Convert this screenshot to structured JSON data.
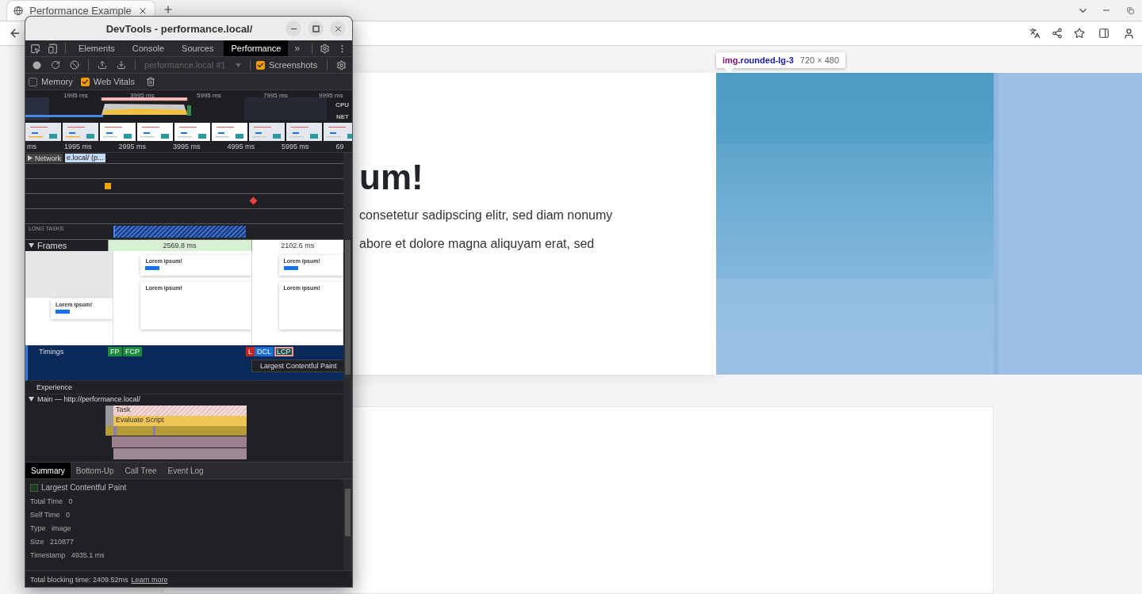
{
  "browser": {
    "tab_title": "Performance Example"
  },
  "page": {
    "inspect_tooltip": {
      "tag": "img",
      "class_name": ".rounded-lg-3",
      "size": "720 × 480"
    },
    "heading": "um!",
    "paragraph_lines": [
      "consetetur sadipscing elitr, sed diam nonumy",
      "abore et dolore magna aliquyam erat, sed"
    ]
  },
  "devtools": {
    "title": "DevTools - performance.local/",
    "tabs": [
      {
        "label": "Elements",
        "selected": false
      },
      {
        "label": "Console",
        "selected": false
      },
      {
        "label": "Sources",
        "selected": false
      },
      {
        "label": "Performance",
        "selected": true
      }
    ],
    "more_tabs": "»",
    "recording_select": "performance.local #1",
    "screenshots_option": {
      "label": "Screenshots",
      "checked": true
    },
    "options": [
      {
        "label": "Memory",
        "checked": false
      },
      {
        "label": "Web Vitals",
        "checked": true
      }
    ],
    "overview": {
      "ticks": [
        "1995 ms",
        "3995 ms",
        "5995 ms",
        "7995 ms",
        "9995 ms"
      ],
      "cpu_label": "CPU",
      "net_label": "NET"
    },
    "ruler": [
      "ms",
      "1995 ms",
      "2995 ms",
      "3995 ms",
      "4995 ms",
      "5995 ms",
      "69"
    ],
    "network": {
      "label": "Network",
      "request": "e.local/ (p..."
    },
    "long_tasks_label": "LONG TASKS",
    "frames": {
      "label": "Frames",
      "durations": [
        "2569.8 ms",
        "2102.6 ms"
      ],
      "screenshots": [
        {
          "headings": [
            "Lorem ipsum!"
          ]
        },
        {
          "headings": [
            "Lorem ipsum!",
            "Lorem ipsum!"
          ]
        },
        {
          "headings": [
            "Lorem ipsum!",
            "Lorem ipsum!"
          ]
        }
      ]
    },
    "timings": {
      "label": "Timings",
      "markers": [
        {
          "label": "FP",
          "color": "#1e8a3c",
          "selected": false
        },
        {
          "label": "FCP",
          "color": "#1e8a3c",
          "selected": false
        },
        {
          "label": "L",
          "color": "#c5221f",
          "selected": false
        },
        {
          "label": "DCL",
          "color": "#1a6fd6",
          "selected": false
        },
        {
          "label": "LCP",
          "color": "#1b4d4a",
          "selected": true
        }
      ],
      "tooltip": "Largest Contentful Paint"
    },
    "experience_label": "Experience",
    "main": {
      "label": "Main — http://performance.local/",
      "events": [
        "Task",
        "Evaluate Script"
      ]
    },
    "bottom_tabs": [
      {
        "label": "Summary",
        "selected": true
      },
      {
        "label": "Bottom-Up",
        "selected": false
      },
      {
        "label": "Call Tree",
        "selected": false
      },
      {
        "label": "Event Log",
        "selected": false
      }
    ],
    "summary": {
      "title": "Largest Contentful Paint",
      "rows": [
        {
          "key": "Total Time",
          "value": "0"
        },
        {
          "key": "Self Time",
          "value": "0"
        },
        {
          "key": "Type",
          "value": "image"
        },
        {
          "key": "Size",
          "value": "210877"
        },
        {
          "key": "Timestamp",
          "value": "4935.1 ms"
        }
      ]
    },
    "footer": {
      "text": "Total blocking time: 2409.52ms",
      "link": "Learn more"
    }
  }
}
